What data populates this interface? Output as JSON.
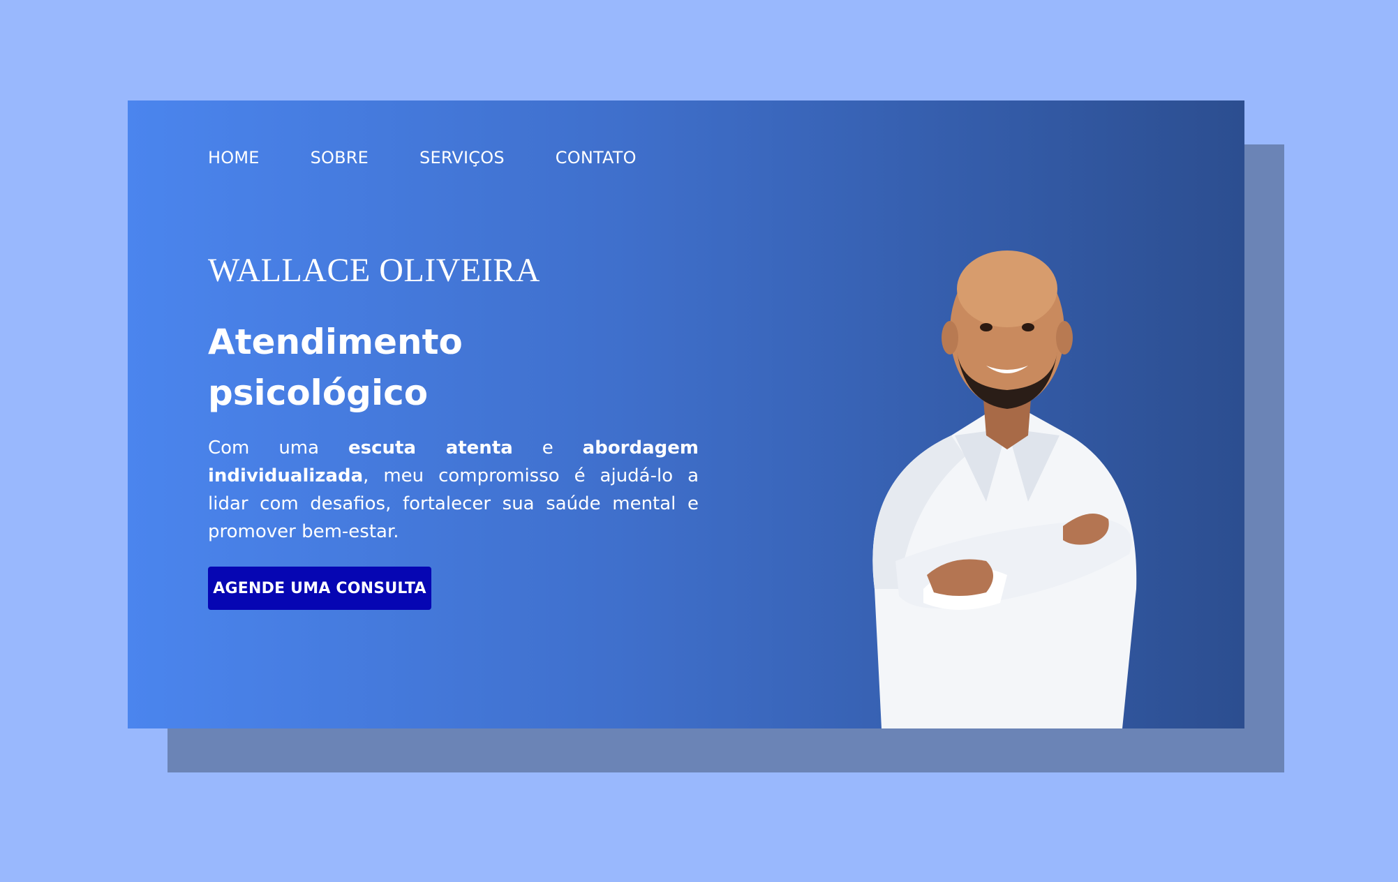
{
  "nav": {
    "items": [
      {
        "label": "HOME"
      },
      {
        "label": "SOBRE"
      },
      {
        "label": "SERVIÇOS"
      },
      {
        "label": "CONTATO"
      }
    ]
  },
  "hero": {
    "name": "WALLACE OLIVEIRA",
    "headline": "Atendimento psicológico",
    "intro": {
      "part1": "Com uma ",
      "bold1": "escuta atenta",
      "part2": " e ",
      "bold2": "abordagem individualizada",
      "part3": ", meu compromisso é ajudá-lo a lidar com desafios, fortalecer sua saúde mental e promover bem-estar."
    },
    "cta_label": "AGENDE UMA CONSULTA"
  },
  "colors": {
    "page_background": "#99b8fd",
    "backdrop_panel": "#6b84b6",
    "gradient_start": "#4b85ee",
    "gradient_end": "#2c4e90",
    "cta_background": "#0606b3"
  },
  "portrait": {
    "icon": "person-photo-icon"
  }
}
